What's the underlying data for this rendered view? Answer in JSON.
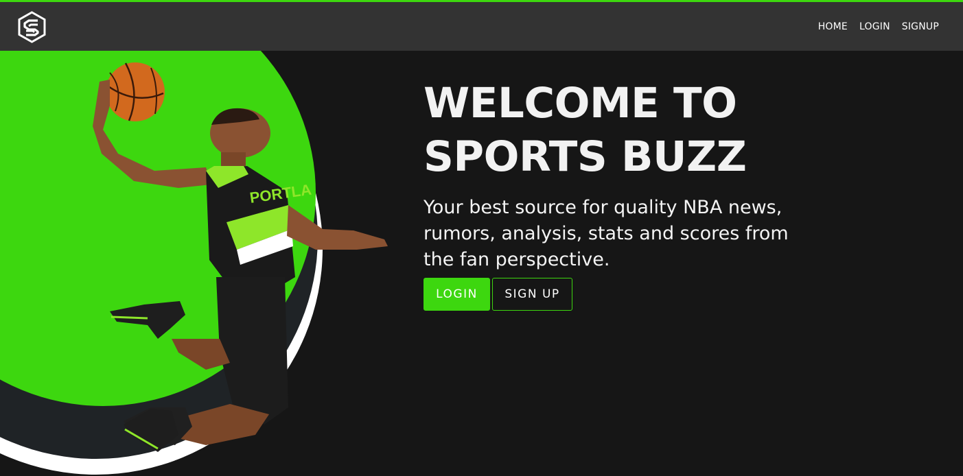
{
  "brand": {
    "logo_icon": "sports-buzz-s-logo-icon",
    "accent_color": "#3dd70f"
  },
  "nav": {
    "items": [
      {
        "label": "HOME"
      },
      {
        "label": "LOGIN"
      },
      {
        "label": "SIGNUP"
      }
    ]
  },
  "hero": {
    "headline_line1": "WELCOME TO",
    "headline_line2": "SPORTS BUZZ",
    "tagline": "Your best source for quality NBA news, rumors, analysis, stats and scores from the fan perspective.",
    "login_button": "LOGIN",
    "signup_button": "SIGN UP",
    "image_alt_icon": "basketball-player-dunk-image",
    "jersey_text": "PORTLA"
  }
}
